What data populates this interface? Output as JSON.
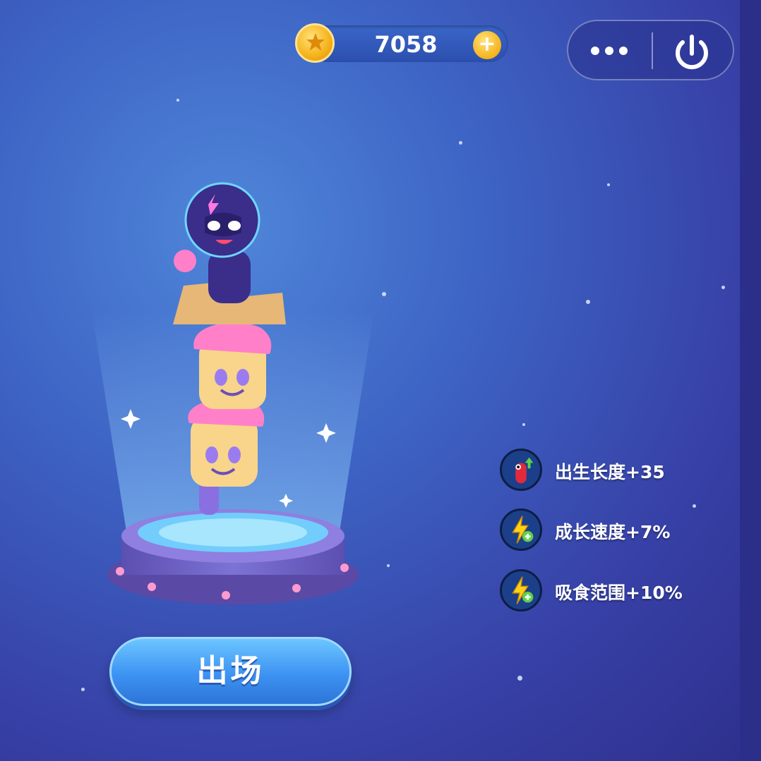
{
  "currency": {
    "value": "7058",
    "add_label": "+"
  },
  "menu": {
    "more_label": "•••"
  },
  "stats": [
    {
      "icon": "snake-growth-icon",
      "label": "出生长度+35"
    },
    {
      "icon": "lightning-plus-icon",
      "label": "成长速度+7%"
    },
    {
      "icon": "lightning-plus-icon",
      "label": "吸食范围+10%"
    }
  ],
  "deploy_button": {
    "label": "出场"
  },
  "colors": {
    "background": "#3d63c4",
    "accent": "#3d93f2",
    "coin": "#f5b21a"
  }
}
